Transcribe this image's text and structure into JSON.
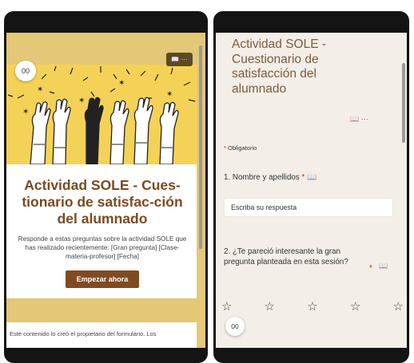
{
  "left": {
    "immersive_icon": "reader-icon",
    "immersive_label": "00",
    "toolbar": {
      "icon_reader": "📖",
      "more": "···"
    },
    "title": "Actividad SOLE - Cues-tionario de satisfac-ción del alumnado",
    "description": "Responde a estas preguntas sobre la actividad SOLE que has realizado recientemente: [Gran pregunta] [Clase-materia-profesor] [Fecha]",
    "start_button": "Empezar ahora",
    "footer": "Este contenido lo creó el propietario del formulario. Los"
  },
  "right": {
    "title": "Actividad SOLE - Cuestionario de satisfacción del alumnado",
    "title_icons": "📖   ···",
    "required_star": "*",
    "required_label": "Obligatorio",
    "q1_label": "1. Nombre y apellidos",
    "q1_star": "*",
    "answer_placeholder": "Escriba su respuesta",
    "q2_label": "2. ¿Te pareció interesante la gran pregunta planteada en esta sesión?",
    "q2_star": "*",
    "reader_icon": "📖",
    "stars": [
      "☆",
      "☆",
      "☆",
      "☆",
      "☆"
    ],
    "immersive_label": "00"
  },
  "colors": {
    "brand_brown": "#7f4b22",
    "banner_yellow": "#f4d257",
    "band_gold": "#e2c877",
    "required_red": "#c5221f"
  }
}
